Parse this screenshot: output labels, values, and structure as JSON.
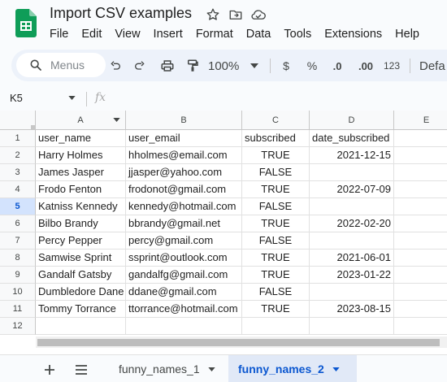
{
  "doc": {
    "title": "Import CSV examples"
  },
  "menu": [
    "File",
    "Edit",
    "View",
    "Insert",
    "Format",
    "Data",
    "Tools",
    "Extensions",
    "Help"
  ],
  "toolbar": {
    "search_placeholder": "Menus",
    "zoom": "100%",
    "currency": "$",
    "percent": "%",
    "decrease_decimal": ".0",
    "increase_decimal": ".00",
    "more_formats": "123",
    "font_partial": "Defa"
  },
  "formula_bar": {
    "cell_ref": "K5",
    "fx": "fx"
  },
  "columns": [
    "A",
    "B",
    "C",
    "D",
    "E"
  ],
  "rows": [
    [
      "user_name",
      "user_email",
      "subscribed",
      "date_subscribed",
      ""
    ],
    [
      "Harry Holmes",
      "hholmes@email.com",
      "TRUE",
      "2021-12-15",
      ""
    ],
    [
      "James Jasper",
      "jjasper@yahoo.com",
      "FALSE",
      "",
      ""
    ],
    [
      "Frodo Fenton",
      "frodonot@gmail.com",
      "TRUE",
      "2022-07-09",
      ""
    ],
    [
      "Katniss Kennedy",
      "kennedy@hotmail.com",
      "FALSE",
      "",
      ""
    ],
    [
      "Bilbo Brandy",
      "bbrandy@gmail.net",
      "TRUE",
      "2022-02-20",
      ""
    ],
    [
      "Percy Pepper",
      "percy@gmail.com",
      "FALSE",
      "",
      ""
    ],
    [
      "Samwise Sprint",
      "ssprint@outlook.com",
      "TRUE",
      "2021-06-01",
      ""
    ],
    [
      "Gandalf Gatsby",
      "gandalfg@gmail.com",
      "TRUE",
      "2023-01-22",
      ""
    ],
    [
      "Dumbledore Dane",
      "ddane@gmail.com",
      "FALSE",
      "",
      ""
    ],
    [
      "Tommy Torrance",
      "ttorrance@hotmail.com",
      "TRUE",
      "2023-08-15",
      ""
    ],
    [
      "",
      "",
      "",
      "",
      ""
    ]
  ],
  "active_row": 5,
  "sheets": [
    {
      "name": "funny_names_1",
      "active": false
    },
    {
      "name": "funny_names_2",
      "active": true
    }
  ],
  "colors": {
    "brand_green": "#0f9d58",
    "accent_blue": "#0b57d0",
    "toolbar_bg": "#edf2fa"
  }
}
